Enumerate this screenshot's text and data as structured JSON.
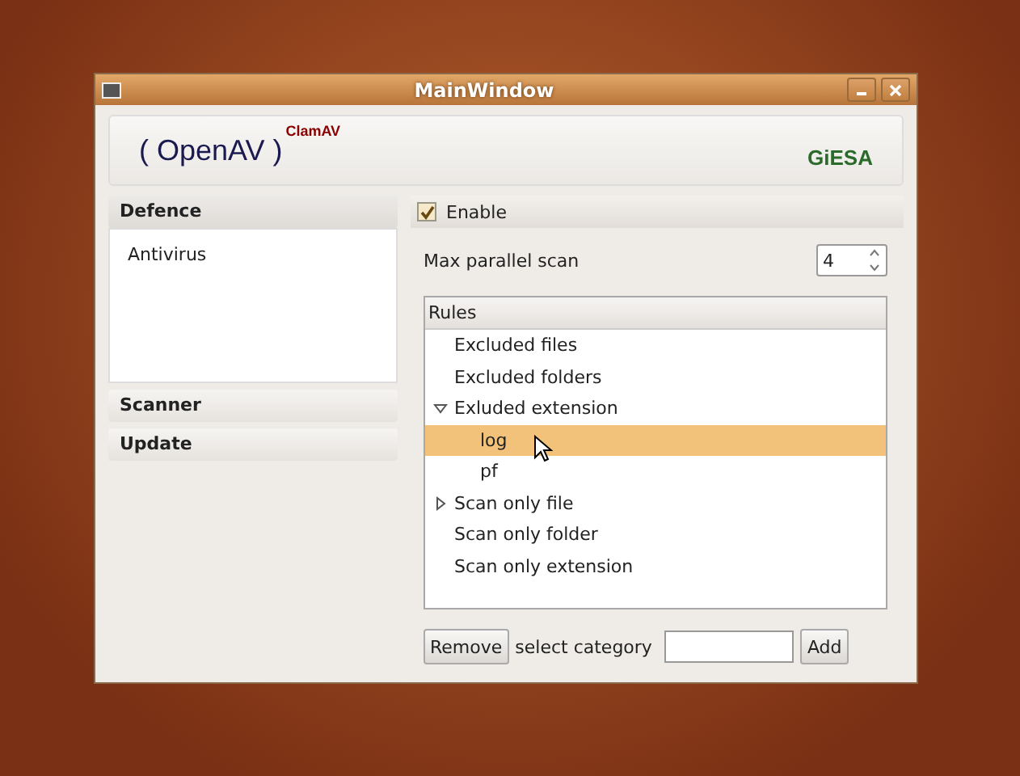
{
  "window": {
    "title": "MainWindow"
  },
  "header": {
    "logo": "( OpenAV )",
    "logo_sup": "ClamAV",
    "brand": "GiESA"
  },
  "sidebar": [
    {
      "title": "Defence",
      "expanded": true,
      "items": [
        "Antivirus"
      ]
    },
    {
      "title": "Scanner",
      "expanded": false
    },
    {
      "title": "Update",
      "expanded": false
    }
  ],
  "enable": {
    "label": "Enable",
    "checked": true
  },
  "max_parallel": {
    "label": "Max parallel scan",
    "value": "4"
  },
  "rules": {
    "header": "Rules",
    "items": [
      {
        "label": "Excluded files",
        "selected": false
      },
      {
        "label": "Excluded folders",
        "selected": false
      },
      {
        "label": "Exluded extension",
        "selected": false,
        "expanded": true,
        "children": [
          {
            "label": "log",
            "selected": true
          },
          {
            "label": "pf",
            "selected": false
          }
        ]
      },
      {
        "label": "Scan only file",
        "selected": false,
        "expanded": false
      },
      {
        "label": "Scan only folder",
        "selected": false
      },
      {
        "label": "Scan only extension",
        "selected": false
      }
    ]
  },
  "footer": {
    "remove": "Remove",
    "category_label": "select category",
    "add": "Add"
  }
}
